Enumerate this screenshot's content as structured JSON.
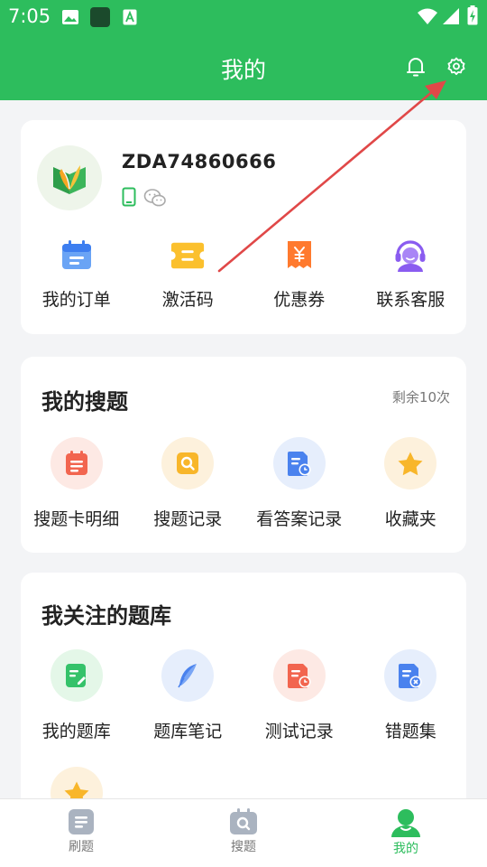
{
  "status_bar": {
    "time": "7:05"
  },
  "header": {
    "title": "我的"
  },
  "profile": {
    "username": "ZDA74860666",
    "quick_actions": [
      {
        "label": "我的订单",
        "icon": "order-icon"
      },
      {
        "label": "激活码",
        "icon": "ticket-icon"
      },
      {
        "label": "优惠券",
        "icon": "coupon-icon"
      },
      {
        "label": "联系客服",
        "icon": "customer-service-icon"
      }
    ]
  },
  "search_section": {
    "title": "我的搜题",
    "remaining": "剩余10次",
    "items": [
      {
        "label": "搜题卡明细",
        "icon": "search-card-icon"
      },
      {
        "label": "搜题记录",
        "icon": "search-history-icon"
      },
      {
        "label": "看答案记录",
        "icon": "answer-record-icon"
      },
      {
        "label": "收藏夹",
        "icon": "favorites-star-icon"
      }
    ]
  },
  "library_section": {
    "title": "我关注的题库",
    "items": [
      {
        "label": "我的题库",
        "icon": "my-bank-icon"
      },
      {
        "label": "题库笔记",
        "icon": "notes-feather-icon"
      },
      {
        "label": "测试记录",
        "icon": "test-record-icon"
      },
      {
        "label": "错题集",
        "icon": "wrong-questions-icon"
      }
    ]
  },
  "tabbar": {
    "tabs": [
      {
        "label": "刷题",
        "icon": "practice-icon"
      },
      {
        "label": "搜题",
        "icon": "search-tab-icon"
      },
      {
        "label": "我的",
        "icon": "profile-tab-icon"
      }
    ],
    "active": "我的"
  },
  "colors": {
    "brand_green": "#2dbd5d",
    "arrow_red": "#e04848"
  }
}
